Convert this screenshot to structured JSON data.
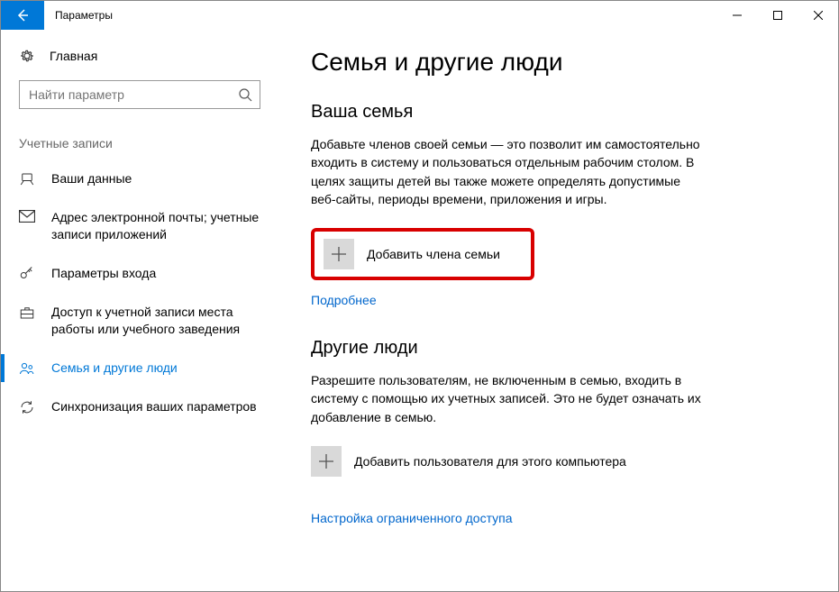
{
  "window": {
    "title": "Параметры"
  },
  "sidebar": {
    "home": "Главная",
    "search_placeholder": "Найти параметр",
    "group": "Учетные записи",
    "items": [
      {
        "label": "Ваши данные"
      },
      {
        "label": "Адрес электронной почты; учетные записи приложений"
      },
      {
        "label": "Параметры входа"
      },
      {
        "label": "Доступ к учетной записи места работы или учебного заведения"
      },
      {
        "label": "Семья и другие люди"
      },
      {
        "label": "Синхронизация ваших параметров"
      }
    ]
  },
  "main": {
    "page_title": "Семья и другие люди",
    "family": {
      "title": "Ваша семья",
      "text": "Добавьте членов своей семьи — это позволит им самостоятельно входить в систему и пользоваться отдельным рабочим столом. В целях защиты детей вы также можете определять допустимые веб-сайты, периоды времени, приложения и игры.",
      "add_label": "Добавить члена семьи",
      "more_link": "Подробнее"
    },
    "others": {
      "title": "Другие люди",
      "text": "Разрешите пользователям, не включенным в семью, входить в систему с помощью их учетных записей. Это не будет означать их добавление в семью.",
      "add_label": "Добавить пользователя для этого компьютера",
      "restricted_link": "Настройка ограниченного доступа"
    }
  }
}
